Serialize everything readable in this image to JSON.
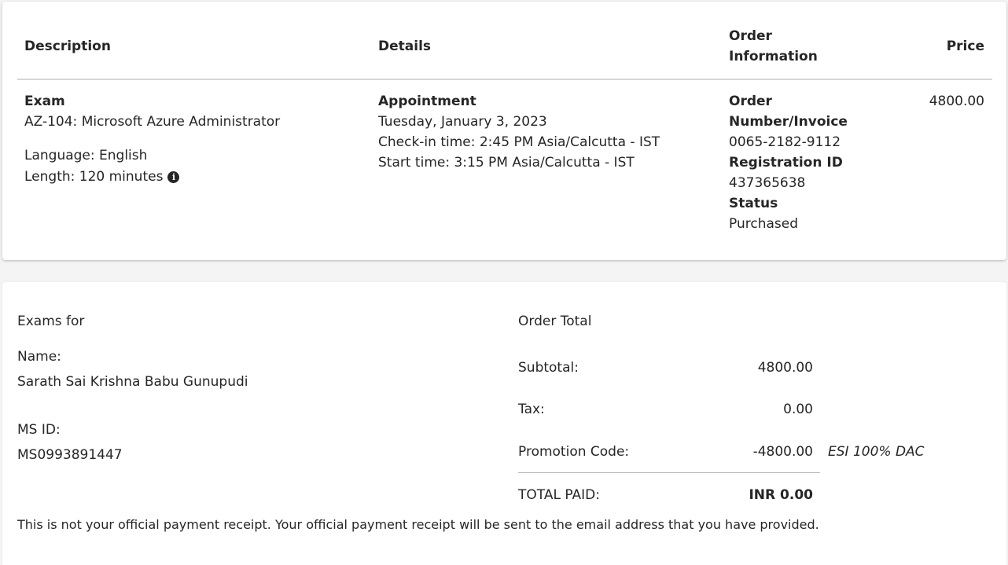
{
  "table": {
    "headers": {
      "description": "Description",
      "details": "Details",
      "order_info_line1": "Order",
      "order_info_line2": "Information",
      "price": "Price"
    },
    "row": {
      "exam_label": "Exam",
      "exam_name": "AZ-104: Microsoft Azure Administrator",
      "language": "Language: English",
      "length": "Length: 120 minutes",
      "appointment_label": "Appointment",
      "appointment_date": "Tuesday, January 3, 2023",
      "checkin_time": "Check-in time: 2:45 PM Asia/Calcutta - IST",
      "start_time": "Start time: 3:15 PM Asia/Calcutta - IST",
      "order_number_label_line1": "Order",
      "order_number_label_line2": "Number/Invoice",
      "order_number": "0065-2182-9112",
      "registration_label": "Registration ID",
      "registration_id": "437365638",
      "status_label": "Status",
      "status": "Purchased",
      "price": "4800.00"
    },
    "info_icon_name": "info-icon",
    "info_icon_glyph": "i"
  },
  "summary": {
    "exams_for": "Exams for",
    "name_label": "Name:",
    "name": "Sarath Sai Krishna Babu Gunupudi",
    "ms_id_label": "MS ID:",
    "ms_id": "MS0993891447",
    "order_total_label": "Order Total",
    "subtotal_label": "Subtotal:",
    "subtotal": "4800.00",
    "tax_label": "Tax:",
    "tax": "0.00",
    "promo_label": "Promotion Code:",
    "promo_amount": "-4800.00",
    "promo_code": "ESI 100% DAC",
    "total_label": "TOTAL PAID:",
    "total": "INR 0.00",
    "note": "This is not your official payment receipt. Your official payment receipt will be sent to the email address that you have provided."
  }
}
